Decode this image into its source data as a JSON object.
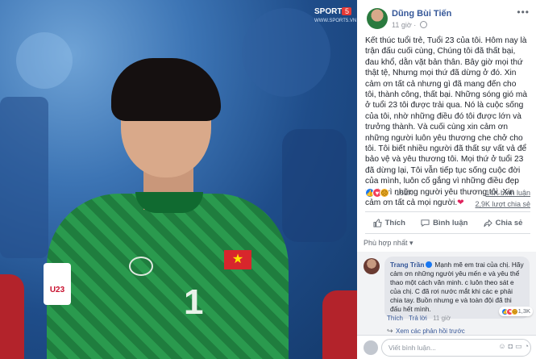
{
  "photo": {
    "watermark": {
      "brand": "SPORT",
      "brand_num": "5",
      "site": "WWW.SPORT5.VN"
    },
    "badge": "U23",
    "shirt_number": "1",
    "flag_star": "★"
  },
  "post": {
    "author": "Dũng Bùi Tiến",
    "time": "11 giờ",
    "more": "•••",
    "text": "Kết thúc tuổi trẻ, Tuổi 23 của tôi. Hôm nay là trận đấu cuối cùng, Chúng tôi đã thất bại, đau khổ, dằn vặt bản thân. Bây giờ mọi thứ thật tệ, Nhưng mọi thứ đã dừng ở đó. Xin cảm ơn tất cả nhưng gì đã mang đến cho tôi, thành công, thất bại. Những sóng gió mà ở tuổi 23 tôi được trải qua. Nó là cuộc sống của tôi, nhờ những điều đó tôi được lớn và trưởng thành. Và cuối cùng xin cảm ơn những người luôn yêu thương che chở cho tôi. Tôi biết nhiều người đã thất sự vất vả để bảo vệ và yêu thương tôi. Mọi thứ ở tuổi 23 đã dừng lại, Tôi vẫn tiếp tục sống cuộc đời của mình, luôn cố gắng vì những điều đẹp nhất, vì những người yêu thương tôi. Xin cảm ơn tất cả mọi người.",
    "heart": "❤",
    "reactions_count": "161K",
    "comments_count": "14K bình luận",
    "shares_count": "2,9K lượt chia sẻ",
    "actions": {
      "like": "Thích",
      "comment": "Bình luận",
      "share": "Chia sẻ"
    },
    "sort_label": "Phù hợp nhất ▾"
  },
  "comment": {
    "author": "Trang Trần",
    "text": "Mạnh mẽ em trai của chị. Hãy cảm ơn những người yêu mến e và yêu thể thao một cách văn minh. c luôn theo sát e của chị. C đã rơi nước mắt khi các e phải chia tay. Buồn nhưng e và toàn đội đã thi đấu hết mình.",
    "reactions_count": "1,3K",
    "like_label": "Thích",
    "reply_label": "Trả lời",
    "time": "11 giờ",
    "more_replies": "Xem các phản hồi trước"
  },
  "composer": {
    "placeholder": "Viết bình luận..."
  },
  "colors": {
    "fb_blue": "#365899",
    "like_blue": "#1877f2",
    "love_red": "#f33e58"
  }
}
